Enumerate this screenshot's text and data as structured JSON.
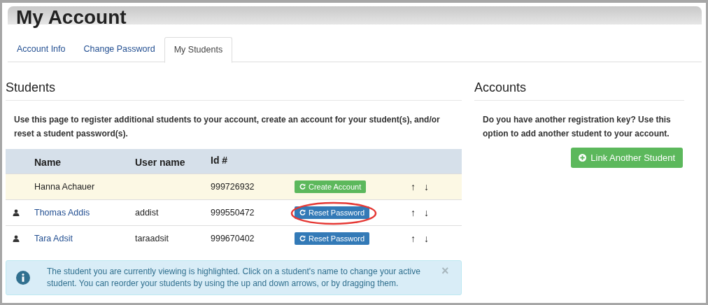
{
  "title": "My Account",
  "tabs": [
    {
      "label": "Account Info",
      "selected": false
    },
    {
      "label": "Change Password",
      "selected": false
    },
    {
      "label": "My Students",
      "selected": true
    }
  ],
  "students": {
    "heading": "Students",
    "intro": "Use this page to register additional students to your account, create an account for your student(s), and/or reset a student password(s).",
    "columns": [
      "Name",
      "User name",
      "Id #"
    ],
    "rows": [
      {
        "name": "Hanna Achauer",
        "username": "",
        "id": "999726932",
        "selected": true,
        "action": {
          "kind": "create",
          "label": "Create Account"
        },
        "circled": false,
        "up": "↑",
        "down": "↓"
      },
      {
        "name": "Thomas Addis",
        "username": "addist",
        "id": "999550472",
        "selected": false,
        "action": {
          "kind": "reset",
          "label": "Reset Password"
        },
        "circled": true,
        "up": "↑",
        "down": "↓"
      },
      {
        "name": "Tara Adsit",
        "username": "taraadsit",
        "id": "999670402",
        "selected": false,
        "action": {
          "kind": "reset",
          "label": "Reset Password"
        },
        "circled": false,
        "up": "↑",
        "down": "↓"
      }
    ],
    "alert": {
      "text": "The student you are currently viewing is highlighted. Click on a student's name to change your active student. You can reorder your students by using the up and down arrows, or by dragging them.",
      "close": "×"
    }
  },
  "accounts": {
    "heading": "Accounts",
    "text": "Do you have another registration key? Use this option to add another student to your account.",
    "button": "Link Another Student"
  }
}
